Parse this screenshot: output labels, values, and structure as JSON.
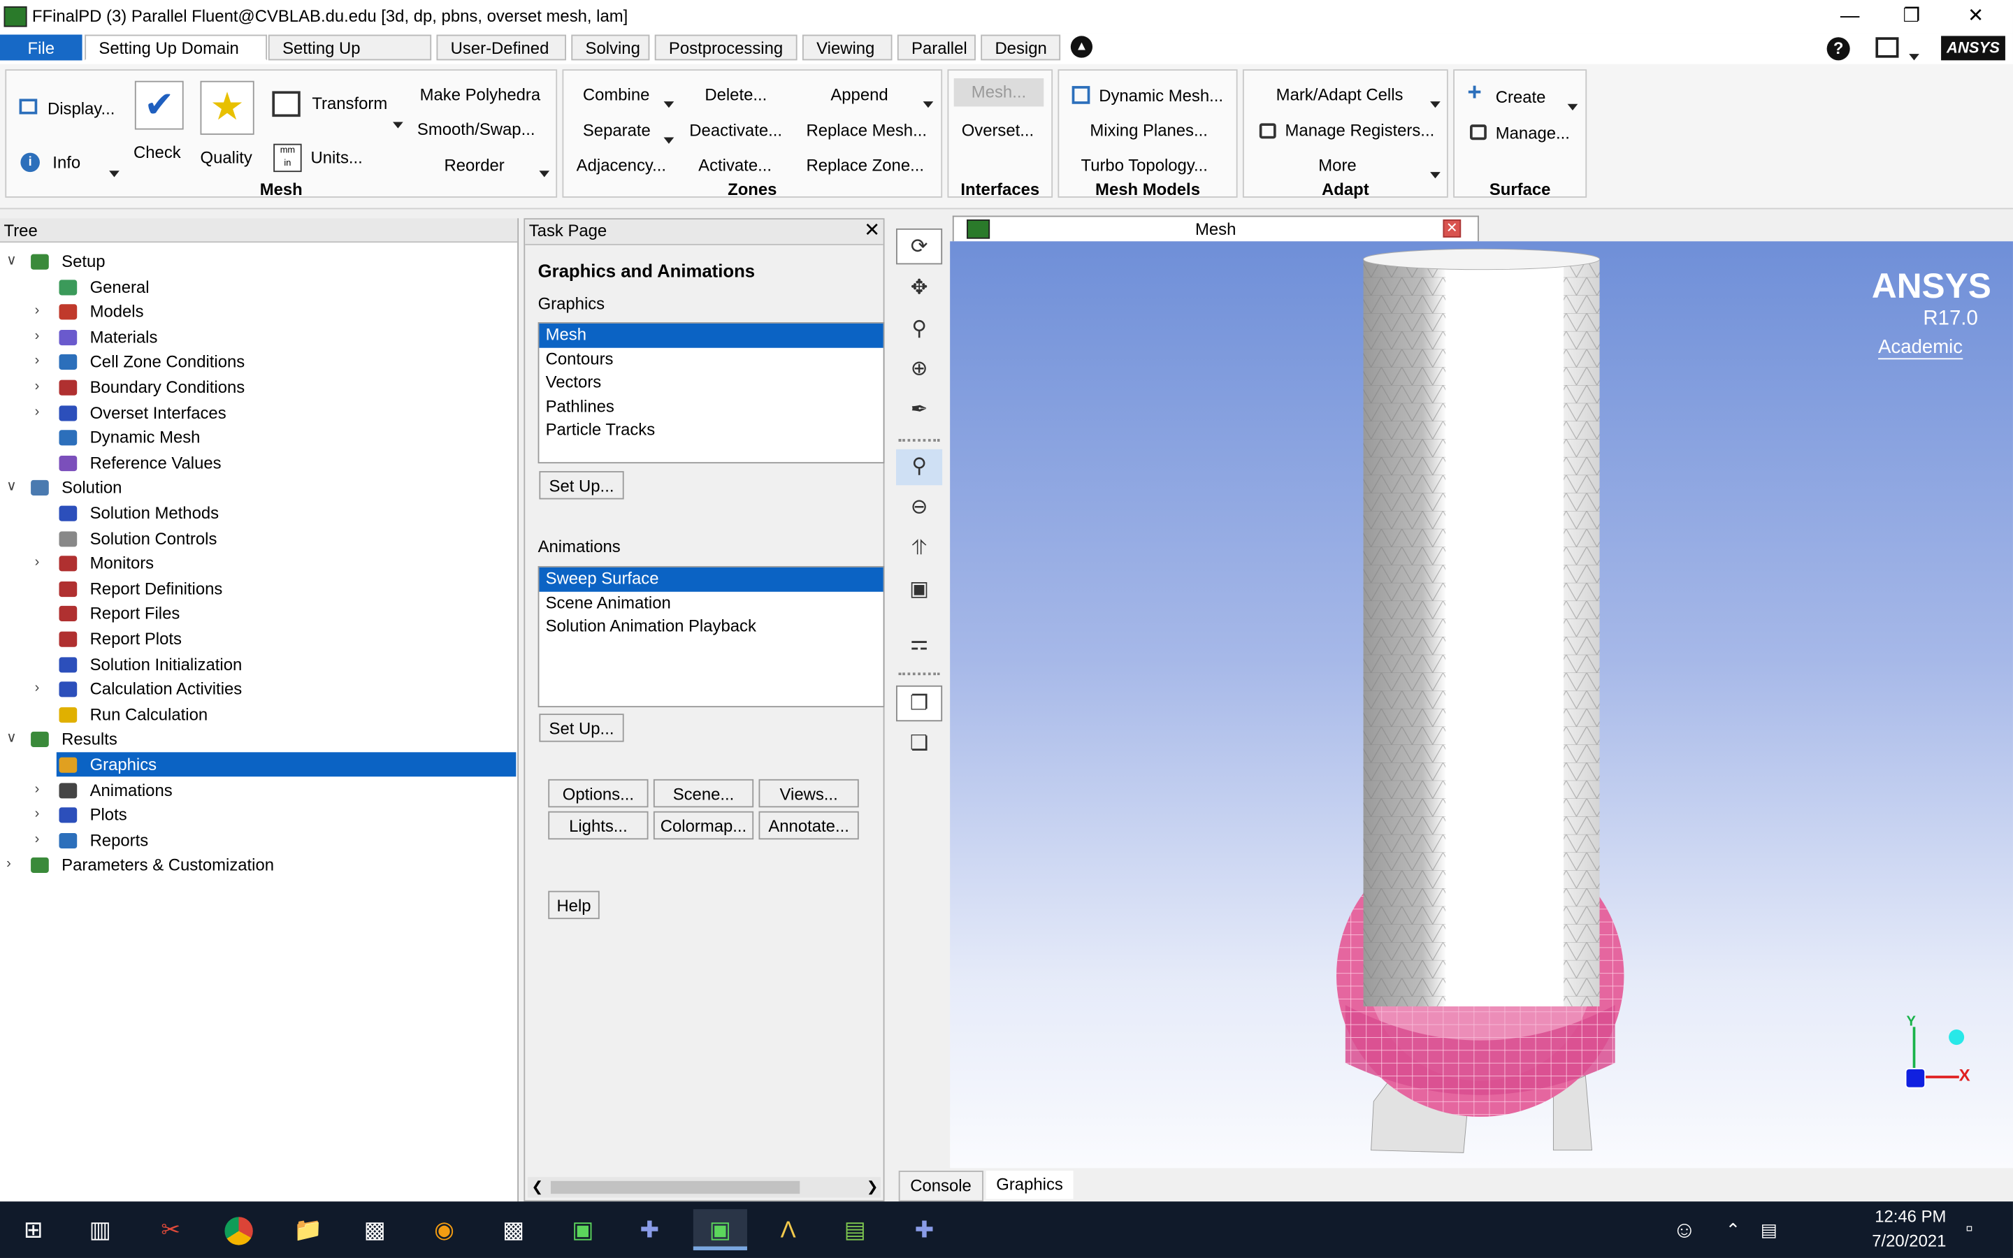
{
  "window": {
    "title": "FFinalPD (3) Parallel Fluent@CVBLAB.du.edu  [3d, dp, pbns, overset mesh, lam]"
  },
  "menu": {
    "file": "File",
    "tabs": [
      "Setting Up Domain",
      "Setting Up Physics",
      "User-Defined",
      "Solving",
      "Postprocessing",
      "Viewing",
      "Parallel",
      "Design"
    ],
    "active_tab": "Setting Up Domain",
    "brand": "ANSYS"
  },
  "ribbon": {
    "mesh_group": {
      "label": "Mesh",
      "display": "Display...",
      "info": "Info",
      "check": "Check",
      "quality": "Quality",
      "transform": "Transform",
      "units": "Units...",
      "make_polyhedra": "Make Polyhedra",
      "smooth_swap": "Smooth/Swap...",
      "reorder": "Reorder"
    },
    "zones_group": {
      "label": "Zones",
      "combine": "Combine",
      "separate": "Separate",
      "adjacency": "Adjacency...",
      "delete": "Delete...",
      "deactivate": "Deactivate...",
      "activate": "Activate...",
      "append": "Append",
      "replace_mesh": "Replace Mesh...",
      "replace_zone": "Replace Zone..."
    },
    "interfaces_group": {
      "label": "Interfaces",
      "mesh": "Mesh...",
      "overset": "Overset..."
    },
    "mesh_models_group": {
      "label": "Mesh Models",
      "dynamic_mesh": "Dynamic Mesh...",
      "mixing_planes": "Mixing Planes...",
      "turbo_topology": "Turbo Topology..."
    },
    "adapt_group": {
      "label": "Adapt",
      "mark_adapt": "Mark/Adapt Cells",
      "manage_registers": "Manage Registers...",
      "more": "More"
    },
    "surface_group": {
      "label": "Surface",
      "create": "Create",
      "manage": "Manage..."
    }
  },
  "tree": {
    "header": "Tree",
    "items": [
      {
        "label": "Setup",
        "level": 0,
        "expander": "open",
        "color": "#3a8a3a"
      },
      {
        "label": "General",
        "level": 1,
        "expander": "",
        "color": "#3b9a5a"
      },
      {
        "label": "Models",
        "level": 1,
        "expander": "closed",
        "color": "#c0392b"
      },
      {
        "label": "Materials",
        "level": 1,
        "expander": "closed",
        "color": "#6a5acd"
      },
      {
        "label": "Cell Zone Conditions",
        "level": 1,
        "expander": "closed",
        "color": "#2c6fbb"
      },
      {
        "label": "Boundary Conditions",
        "level": 1,
        "expander": "closed",
        "color": "#b03030"
      },
      {
        "label": "Overset Interfaces",
        "level": 1,
        "expander": "closed",
        "color": "#2c4fbb"
      },
      {
        "label": "Dynamic Mesh",
        "level": 1,
        "expander": "",
        "color": "#2c6fbb"
      },
      {
        "label": "Reference Values",
        "level": 1,
        "expander": "",
        "color": "#7b4fbb"
      },
      {
        "label": "Solution",
        "level": 0,
        "expander": "open",
        "color": "#4a7ab0"
      },
      {
        "label": "Solution Methods",
        "level": 1,
        "expander": "",
        "color": "#2c4fbb"
      },
      {
        "label": "Solution Controls",
        "level": 1,
        "expander": "",
        "color": "#888888"
      },
      {
        "label": "Monitors",
        "level": 1,
        "expander": "closed",
        "color": "#b03030"
      },
      {
        "label": "Report Definitions",
        "level": 1,
        "expander": "",
        "color": "#b03030"
      },
      {
        "label": "Report Files",
        "level": 1,
        "expander": "",
        "color": "#b03030"
      },
      {
        "label": "Report Plots",
        "level": 1,
        "expander": "",
        "color": "#b03030"
      },
      {
        "label": "Solution Initialization",
        "level": 1,
        "expander": "",
        "color": "#2c4fbb"
      },
      {
        "label": "Calculation Activities",
        "level": 1,
        "expander": "closed",
        "color": "#2c4fbb"
      },
      {
        "label": "Run Calculation",
        "level": 1,
        "expander": "",
        "color": "#e0b000"
      },
      {
        "label": "Results",
        "level": 0,
        "expander": "open",
        "color": "#3a8a3a"
      },
      {
        "label": "Graphics",
        "level": 1,
        "expander": "closed",
        "color": "#e0a020",
        "selected": true
      },
      {
        "label": "Animations",
        "level": 1,
        "expander": "closed",
        "color": "#444444"
      },
      {
        "label": "Plots",
        "level": 1,
        "expander": "closed",
        "color": "#2c4fbb"
      },
      {
        "label": "Reports",
        "level": 1,
        "expander": "closed",
        "color": "#2c6fbb"
      },
      {
        "label": "Parameters & Customization",
        "level": 0,
        "expander": "closed",
        "color": "#3a8a3a"
      }
    ]
  },
  "task_page": {
    "header": "Task Page",
    "title": "Graphics and Animations",
    "graphics_label": "Graphics",
    "graphics_items": [
      "Mesh",
      "Contours",
      "Vectors",
      "Pathlines",
      "Particle Tracks"
    ],
    "graphics_selected": "Mesh",
    "setup1": "Set Up...",
    "animations_label": "Animations",
    "animation_items": [
      "Sweep Surface",
      "Scene Animation",
      "Solution Animation Playback"
    ],
    "animation_selected": "Sweep Surface",
    "setup2": "Set Up...",
    "options": "Options...",
    "scene": "Scene...",
    "views": "Views...",
    "lights": "Lights...",
    "colormap": "Colormap...",
    "annotate": "Annotate...",
    "help": "Help"
  },
  "graphics_window": {
    "tab_title": "Mesh",
    "watermark_brand": "ANSYS",
    "watermark_version": "R17.0",
    "watermark_edition": "Academic",
    "axis_x": "X",
    "axis_y": "Y"
  },
  "bottom_tabs": [
    "Console",
    "Graphics"
  ],
  "bottom_active": "Graphics",
  "taskbar": {
    "time": "12:46 PM",
    "date": "7/20/2021"
  }
}
